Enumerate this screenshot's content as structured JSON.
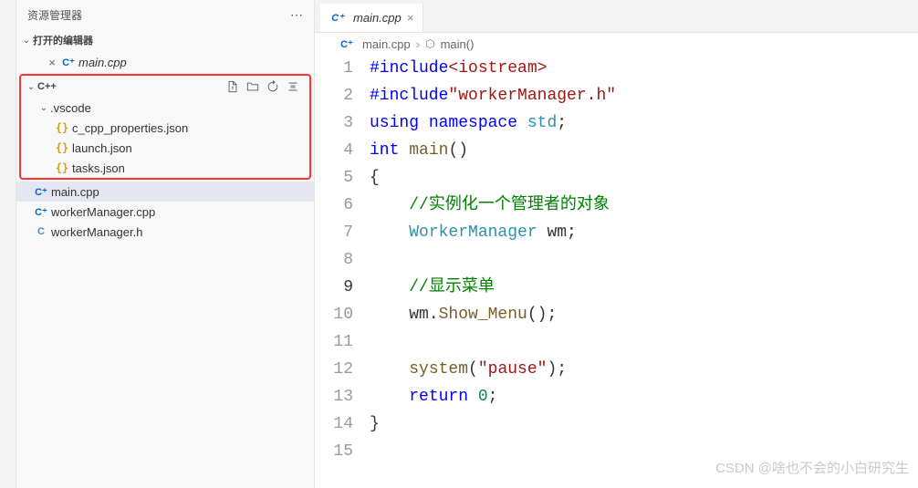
{
  "sidebar": {
    "title": "资源管理器",
    "open_editors_label": "打开的编辑器",
    "open_editor_file": "main.cpp",
    "project_label": "C++",
    "vscode_folder": ".vscode",
    "vscode_files": [
      "c_cpp_properties.json",
      "launch.json",
      "tasks.json"
    ],
    "selected_file": "main.cpp",
    "other_files": [
      "workerManager.cpp",
      "workerManager.h"
    ]
  },
  "tabs": {
    "active": "main.cpp"
  },
  "breadcrumb": {
    "file": "main.cpp",
    "symbol": "main()"
  },
  "code": {
    "current_line": 9,
    "lines": [
      {
        "n": 1,
        "t": [
          [
            "macro",
            "#include"
          ],
          [
            "string",
            "<iostream>"
          ]
        ]
      },
      {
        "n": 2,
        "t": [
          [
            "macro",
            "#include"
          ],
          [
            "string",
            "\"workerManager.h\""
          ]
        ]
      },
      {
        "n": 3,
        "t": [
          [
            "keyword",
            "using "
          ],
          [
            "keyword",
            "namespace "
          ],
          [
            "type",
            "std"
          ],
          [
            "plain",
            ";"
          ]
        ]
      },
      {
        "n": 4,
        "t": [
          [
            "keyword",
            "int "
          ],
          [
            "func",
            "main"
          ],
          [
            "plain",
            "()"
          ]
        ]
      },
      {
        "n": 5,
        "t": [
          [
            "plain",
            "{"
          ]
        ]
      },
      {
        "n": 6,
        "t": [
          [
            "plain",
            "    "
          ],
          [
            "comment",
            "//实例化一个管理者的对象"
          ]
        ]
      },
      {
        "n": 7,
        "t": [
          [
            "plain",
            "    "
          ],
          [
            "type",
            "WorkerManager"
          ],
          [
            "plain",
            " wm;"
          ]
        ]
      },
      {
        "n": 8,
        "t": []
      },
      {
        "n": 9,
        "t": [
          [
            "plain",
            "    "
          ],
          [
            "comment",
            "//显示菜单"
          ]
        ]
      },
      {
        "n": 10,
        "t": [
          [
            "plain",
            "    wm."
          ],
          [
            "func",
            "Show_Menu"
          ],
          [
            "plain",
            "();"
          ]
        ]
      },
      {
        "n": 11,
        "t": []
      },
      {
        "n": 12,
        "t": [
          [
            "plain",
            "    "
          ],
          [
            "func",
            "system"
          ],
          [
            "plain",
            "("
          ],
          [
            "string",
            "\"pause\""
          ],
          [
            "plain",
            ");"
          ]
        ]
      },
      {
        "n": 13,
        "t": [
          [
            "plain",
            "    "
          ],
          [
            "keyword",
            "return "
          ],
          [
            "num",
            "0"
          ],
          [
            "plain",
            ";"
          ]
        ]
      },
      {
        "n": 14,
        "t": [
          [
            "plain",
            "}"
          ]
        ]
      },
      {
        "n": 15,
        "t": []
      }
    ]
  },
  "watermark": "CSDN @啥也不会的小白研究生"
}
